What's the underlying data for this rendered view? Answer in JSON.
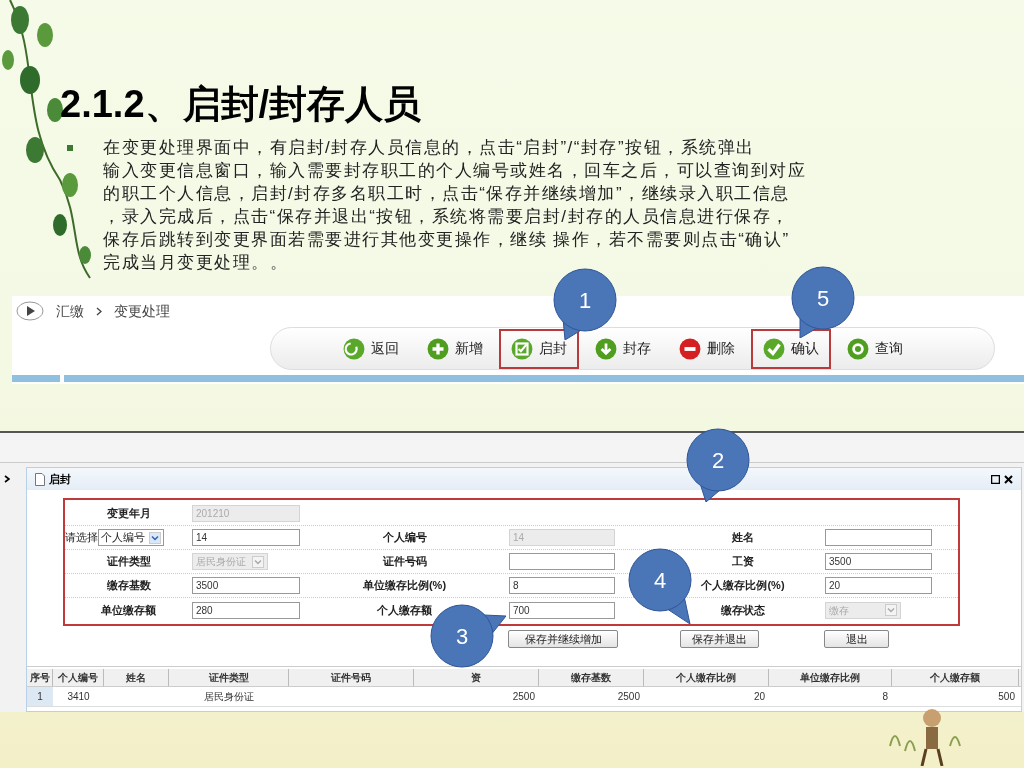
{
  "title": "2.1.2、启封/封存人员",
  "body_lines": [
    "在变更处理界面中，有启封/封存人员信息的，点击“启封”/“封存”按钮，系统弹出",
    "输入变更信息窗口，输入需要封存职工的个人编号或姓名，回车之后，可以查询到对应",
    "的职工个人信息，启封/封存多名职工时，点击“保存并继续增加”，继续录入职工信息",
    "，录入完成后，点击“保存并退出“按钮，系统将需要启封/封存的人员信息进行保存，",
    "保存后跳转到变更界面若需要进行其他变更操作，继续 操作，若不需要则点击“确认”",
    "完成当月变更处理。。"
  ],
  "breadcrumb": [
    "汇缴",
    "变更处理"
  ],
  "toolbar": [
    {
      "label": "返回",
      "kind": "back",
      "color": "#5aa82a",
      "highlighted": false
    },
    {
      "label": "新增",
      "kind": "add",
      "color": "#4f9e1f",
      "highlighted": false
    },
    {
      "label": "启封",
      "kind": "edit",
      "color": "#5aa82a",
      "highlighted": true
    },
    {
      "label": "封存",
      "kind": "down",
      "color": "#4f9e1f",
      "highlighted": false
    },
    {
      "label": "删除",
      "kind": "remove",
      "color": "#d42020",
      "highlighted": false
    },
    {
      "label": "确认",
      "kind": "confirm",
      "color": "#5aa82a",
      "highlighted": true
    },
    {
      "label": "查询",
      "kind": "search",
      "color": "#4f9e1f",
      "highlighted": false
    }
  ],
  "dialog": {
    "title": "启封",
    "form_rows": [
      [
        {
          "label": "变更年月",
          "field": {
            "kind": "input",
            "value": "201210",
            "disabled": true
          }
        }
      ],
      [
        {
          "prefix": "请选择",
          "label_select": "个人编号",
          "field": {
            "kind": "input",
            "value": "14",
            "disabled": false
          }
        },
        {
          "label": "个人编号",
          "field": {
            "kind": "input",
            "value": "14",
            "disabled": true
          }
        },
        {
          "label": "姓名",
          "field": {
            "kind": "input",
            "disabled": false
          }
        }
      ],
      [
        {
          "label": "证件类型",
          "field": {
            "kind": "select",
            "value": "居民身份证",
            "disabled": true
          }
        },
        {
          "label": "证件号码",
          "field": {
            "kind": "input",
            "disabled": false
          }
        },
        {
          "label": "工资",
          "field": {
            "kind": "input",
            "value": "3500",
            "disabled": false
          }
        }
      ],
      [
        {
          "label": "缴存基数",
          "field": {
            "kind": "input",
            "value": "3500",
            "disabled": false
          }
        },
        {
          "label": "单位缴存比例(%)",
          "field": {
            "kind": "input",
            "value": "8",
            "disabled": false
          }
        },
        {
          "label": "个人缴存比例(%)",
          "field": {
            "kind": "input",
            "value": "20",
            "disabled": false
          }
        }
      ],
      [
        {
          "label": "单位缴存额",
          "field": {
            "kind": "input",
            "value": "280",
            "disabled": false
          }
        },
        {
          "label": "个人缴存额",
          "field": {
            "kind": "input",
            "value": "700",
            "disabled": false
          }
        },
        {
          "label": "缴存状态",
          "field": {
            "kind": "select",
            "value": "缴存",
            "disabled": true
          }
        }
      ]
    ],
    "buttons": [
      "保存并继续增加",
      "保存并退出",
      "退出"
    ]
  },
  "table": {
    "columns": [
      "序号",
      "个人编号",
      "姓名",
      "证件类型",
      "证件号码",
      "资",
      "缴存基数",
      "个人缴存比例",
      "单位缴存比例",
      "个人缴存额"
    ],
    "rows": [
      [
        "1",
        "3410",
        "",
        "居民身份证",
        "",
        "2500",
        "2500",
        "20",
        "8",
        "500"
      ]
    ]
  },
  "callouts": [
    "1",
    "5",
    "2",
    "3",
    "4"
  ]
}
